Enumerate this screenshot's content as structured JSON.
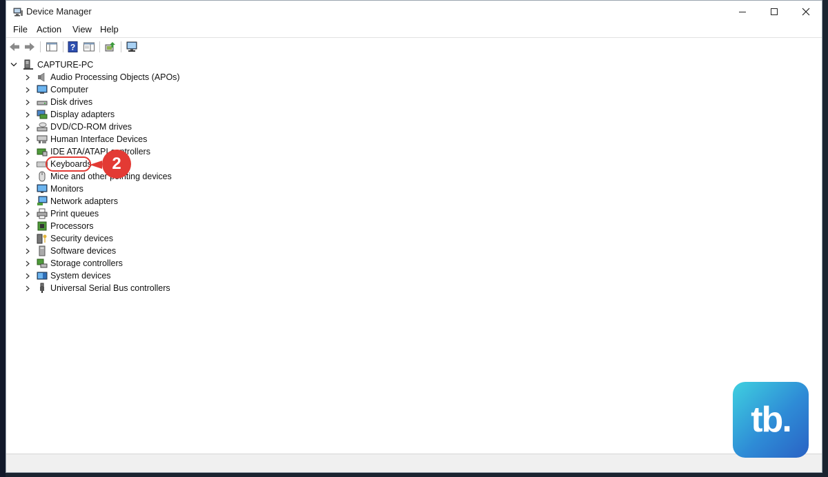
{
  "window": {
    "title": "Device Manager"
  },
  "menu": [
    "File",
    "Action",
    "View",
    "Help"
  ],
  "tree": {
    "root": "CAPTURE-PC",
    "items": [
      {
        "label": "Audio Processing Objects (APOs)",
        "icon": "speaker-icon"
      },
      {
        "label": "Computer",
        "icon": "computer-icon"
      },
      {
        "label": "Disk drives",
        "icon": "disk-drive-icon"
      },
      {
        "label": "Display adapters",
        "icon": "display-adapter-icon"
      },
      {
        "label": "DVD/CD-ROM drives",
        "icon": "dvd-drive-icon"
      },
      {
        "label": "Human Interface Devices",
        "icon": "hid-icon"
      },
      {
        "label": "IDE ATA/ATAPI controllers",
        "icon": "ide-controller-icon"
      },
      {
        "label": "Keyboards",
        "icon": "keyboard-icon"
      },
      {
        "label": "Mice and other pointing devices",
        "icon": "mouse-icon"
      },
      {
        "label": "Monitors",
        "icon": "monitor-icon"
      },
      {
        "label": "Network adapters",
        "icon": "network-adapter-icon"
      },
      {
        "label": "Print queues",
        "icon": "printer-icon"
      },
      {
        "label": "Processors",
        "icon": "processor-icon"
      },
      {
        "label": "Security devices",
        "icon": "security-device-icon"
      },
      {
        "label": "Software devices",
        "icon": "software-device-icon"
      },
      {
        "label": "Storage controllers",
        "icon": "storage-controller-icon"
      },
      {
        "label": "System devices",
        "icon": "system-device-icon"
      },
      {
        "label": "Universal Serial Bus controllers",
        "icon": "usb-icon"
      }
    ]
  },
  "callout": {
    "number": "2"
  },
  "logo": {
    "text": "tb."
  },
  "colors": {
    "callout": "#e33a34",
    "logo_start": "#3fd0e0",
    "logo_end": "#2a62c4"
  }
}
